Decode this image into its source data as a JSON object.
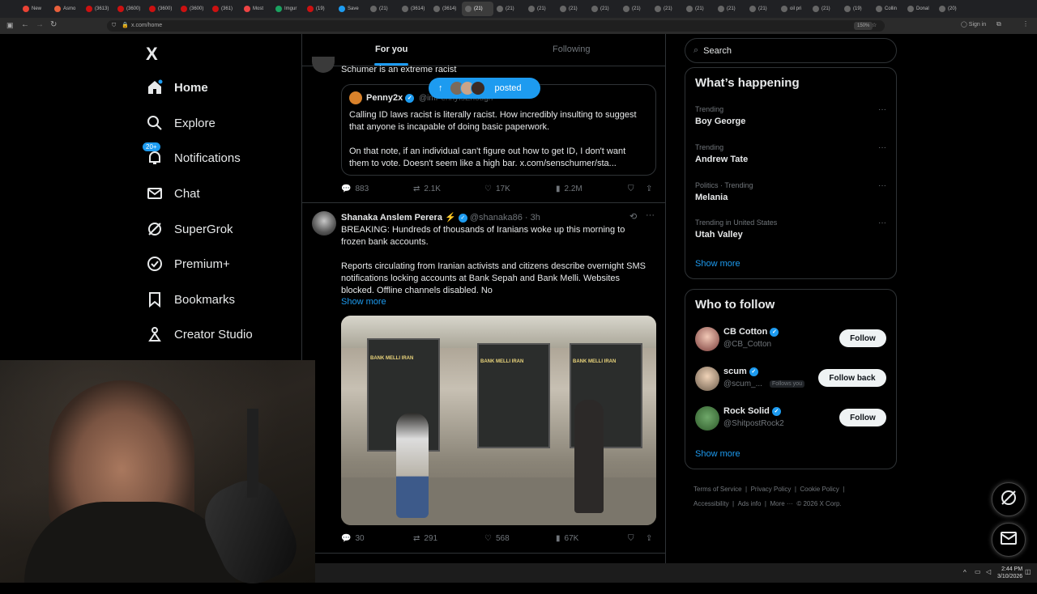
{
  "browser": {
    "tabs": [
      "New",
      "Asmo",
      "(3613)",
      "(3600)",
      "(3600)",
      "(3600)",
      "(361)",
      "Most",
      "Imgur",
      "(19)",
      "Save",
      "(21)",
      "(3614)",
      "(3614)",
      "(21)",
      "(21)",
      "(21)",
      "(21)",
      "(21)",
      "(21)",
      "(21)",
      "(21)",
      "(21)",
      "(21)",
      "oil pri",
      "(21)",
      "(19)",
      "Collin",
      "Donal",
      "(20)"
    ],
    "url": "x.com/home",
    "zoom": "150%",
    "signin": "Sign in"
  },
  "nav": {
    "logo": "X",
    "items": [
      {
        "label": "Home",
        "icon": "home-icon"
      },
      {
        "label": "Explore",
        "icon": "search-icon"
      },
      {
        "label": "Notifications",
        "icon": "bell-icon",
        "badge": "20+"
      },
      {
        "label": "Chat",
        "icon": "mail-icon"
      },
      {
        "label": "SuperGrok",
        "icon": "grok-icon"
      },
      {
        "label": "Premium+",
        "icon": "verified-icon"
      },
      {
        "label": "Bookmarks",
        "icon": "bookmark-icon"
      },
      {
        "label": "Creator Studio",
        "icon": "creator-icon"
      }
    ]
  },
  "feed": {
    "tabs": [
      "For you",
      "Following"
    ],
    "posted_pill": "posted",
    "tweet1": {
      "text_top": "Schumer is an extreme racist",
      "quote_name": "Penny2x",
      "quote_handle": "@imPennyIsEnough",
      "quote_text1": "Calling ID laws racist is literally racist. How incredibly insulting to suggest that anyone is incapable of doing basic paperwork.",
      "quote_text2": "On that note, if an individual can't figure out how to get ID, I don't want them to vote. Doesn't seem like a high bar. x.com/senschumer/sta...",
      "replies": "883",
      "retweets": "2.1K",
      "likes": "17K",
      "views": "2.2M"
    },
    "tweet2": {
      "name": "Shanaka Anslem Perera",
      "emoji": "⚡",
      "handle": "@shanaka86",
      "time": "· 3h",
      "text1": "BREAKING: Hundreds of thousands of Iranians woke up this morning to frozen bank accounts.",
      "text2": "Reports circulating from Iranian activists and citizens describe overnight SMS notifications locking accounts at Bank Sepah and Bank Melli. Websites blocked. Offline channels disabled. No",
      "show_more": "Show more",
      "sign": "BANK MELLI IRAN",
      "replies": "30",
      "retweets": "291",
      "likes": "568",
      "views": "67K"
    }
  },
  "right": {
    "search_placeholder": "Search",
    "happening_title": "What’s happening",
    "trends": [
      {
        "sub": "Trending",
        "main": "Boy George"
      },
      {
        "sub": "Trending",
        "main": "Andrew Tate"
      },
      {
        "sub": "Politics · Trending",
        "main": "Melania"
      },
      {
        "sub": "Trending in United States",
        "main": "Utah Valley"
      }
    ],
    "show_more": "Show more",
    "wtf_title": "Who to follow",
    "follow": [
      {
        "name": "CB Cotton",
        "handle": "@CB_Cotton",
        "button": "Follow",
        "note": ""
      },
      {
        "name": "scum",
        "handle": "@scum_...",
        "button": "Follow back",
        "note": "Follows you"
      },
      {
        "name": "Rock Solid",
        "handle": "@ShitpostRock2",
        "button": "Follow",
        "note": ""
      }
    ],
    "footer": [
      "Terms of Service",
      "|",
      "Privacy Policy",
      "|",
      "Cookie Policy",
      "|",
      "Accessibility",
      "|",
      "Ads info",
      "|",
      "More ···",
      "© 2026 X Corp."
    ]
  },
  "taskbar": {
    "time": "2:44 PM",
    "date": "3/10/2026"
  },
  "colors": {
    "accent": "#1d9bf0",
    "border": "#2f3336",
    "muted": "#71767b"
  }
}
